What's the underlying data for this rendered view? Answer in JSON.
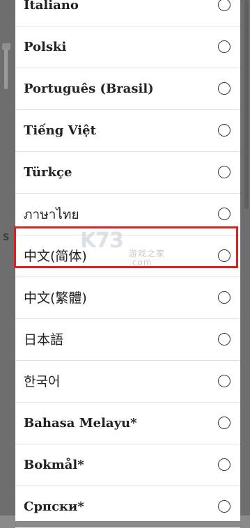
{
  "languages": [
    {
      "label": "Italiano"
    },
    {
      "label": "Polski"
    },
    {
      "label": "Português (Brasil)"
    },
    {
      "label": "Tiếng Việt"
    },
    {
      "label": "Türkçe"
    },
    {
      "label": "ภาษาไทย"
    },
    {
      "label": "中文(简体)"
    },
    {
      "label": "中文(繁體)"
    },
    {
      "label": "日本語"
    },
    {
      "label": "한국어"
    },
    {
      "label": "Bahasa Melayu*"
    },
    {
      "label": "Bokmål*"
    },
    {
      "label": "Српски*"
    }
  ],
  "highlighted_index": 6,
  "background": {
    "side_letters": [
      "S"
    ]
  },
  "watermark": {
    "logo": "K73",
    "site": "游戏之家",
    "domain": ".com"
  },
  "colors": {
    "highlight": "#e0201f",
    "sheet": "#ffffff",
    "overlay": "#7d7d7d"
  }
}
